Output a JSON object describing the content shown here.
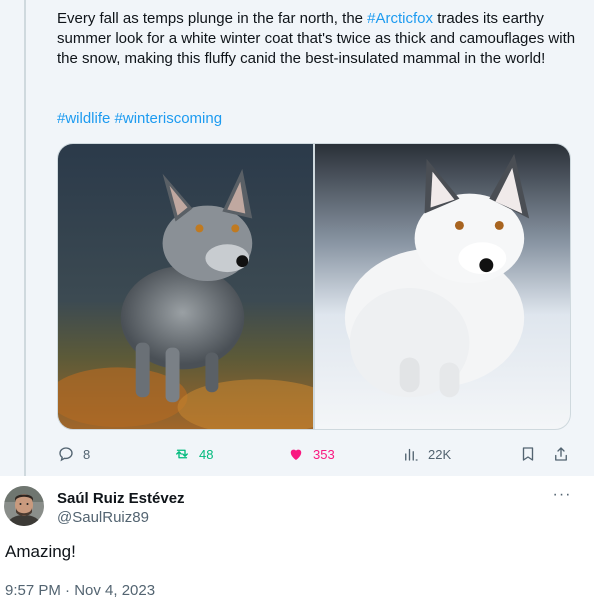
{
  "quoted_tweet": {
    "text_before_link": "Every fall as temps plunge in the far north, the ",
    "link": "#Arcticfox",
    "text_after_link": " trades its earthy summer look for a white winter coat that's twice as thick and camouflages with the snow, making this fluffy canid the best-insulated mammal in the world!",
    "hashtags": "#wildlife #winteriscoming",
    "media": [
      {
        "icon": "arctic-fox-grey-summer-photo"
      },
      {
        "icon": "arctic-fox-white-winter-photo"
      }
    ],
    "actions": {
      "replies": "8",
      "retweets": "48",
      "likes": "353",
      "views": "22K"
    },
    "colors": {
      "link": "#1d9bf0",
      "retweet": "#00ba7c",
      "like": "#f91880",
      "muted": "#536471"
    }
  },
  "reply": {
    "display_name": "Saúl Ruiz Estévez",
    "handle": "@SaulRuiz89",
    "more_label": "···",
    "text": "Amazing!",
    "timestamp": "9:57 PM · Nov 4, 2023"
  }
}
